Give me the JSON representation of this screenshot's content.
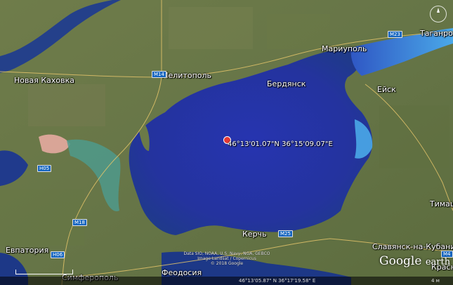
{
  "cities": [
    {
      "id": "nova-kakhovka",
      "name": "Новая Каховка"
    },
    {
      "id": "melitopol",
      "name": "Мелитополь"
    },
    {
      "id": "mariupol",
      "name": "Мариуполь"
    },
    {
      "id": "taganrog",
      "name": "Таганрог"
    },
    {
      "id": "berdyansk",
      "name": "Бердянск"
    },
    {
      "id": "yeysk",
      "name": "Ейск"
    },
    {
      "id": "kerch",
      "name": "Керчь"
    },
    {
      "id": "evpatoria",
      "name": "Евпатория"
    },
    {
      "id": "simferopol",
      "name": "Симферополь"
    },
    {
      "id": "feodosia",
      "name": "Феодосия"
    },
    {
      "id": "slavyansk",
      "name": "Славянск-на-Кубани"
    },
    {
      "id": "timashevsk",
      "name": "Тимаш"
    },
    {
      "id": "krasnodar",
      "name": "Красн"
    }
  ],
  "roads": [
    "M23",
    "M14",
    "H05",
    "M18",
    "H06",
    "M25",
    "M4"
  ],
  "marker": {
    "coordinates": "46°13'01.07\"N 36°15'09.07\"E",
    "color": "#e53935"
  },
  "copyright": "Data SIO, NOAA, U.S. Navy, NGA, GEBCO\nImage Landsat / Copernicus\n© 2018 Google",
  "brand": {
    "name": "Google",
    "suffix": "earth"
  },
  "status": {
    "left": "46°13'05.87\" N 36°17'19.58\" E",
    "right": "4 м"
  },
  "colors": {
    "sea": "#2231a8",
    "shallow": "#3f86d8",
    "land": "#6b7a48"
  }
}
